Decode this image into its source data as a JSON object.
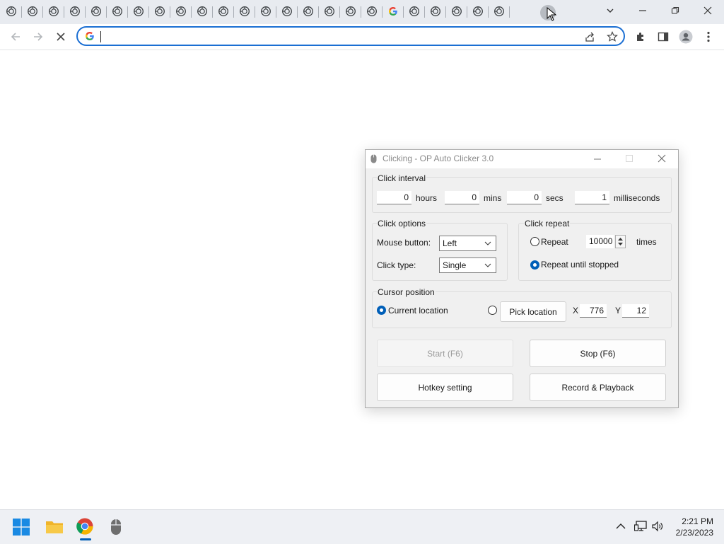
{
  "browser": {
    "tab_count": 24,
    "search_value": "",
    "buttons": {
      "back": "back",
      "forward": "forward",
      "stop": "stop loading",
      "share": "share",
      "bookmark": "bookmark",
      "extensions": "extensions",
      "side_panel": "side panel",
      "profile": "profile",
      "menu": "menu"
    }
  },
  "autoclicker": {
    "title": "Clicking - OP Auto Clicker 3.0",
    "interval": {
      "label": "Click interval",
      "hours_value": "0",
      "hours_label": "hours",
      "mins_value": "0",
      "mins_label": "mins",
      "secs_value": "0",
      "secs_label": "secs",
      "ms_value": "1",
      "ms_label": "milliseconds"
    },
    "options": {
      "label": "Click options",
      "mouse_button_label": "Mouse button:",
      "mouse_button_value": "Left",
      "click_type_label": "Click type:",
      "click_type_value": "Single"
    },
    "repeat": {
      "label": "Click repeat",
      "repeat_label": "Repeat",
      "repeat_count": "10000",
      "times_label": "times",
      "until_stopped_label": "Repeat until stopped",
      "selected": "until_stopped"
    },
    "cursor": {
      "label": "Cursor position",
      "current_label": "Current location",
      "pick_label": "Pick location",
      "x_label": "X",
      "x_value": "776",
      "y_label": "Y",
      "y_value": "12",
      "selected": "current"
    },
    "buttons": {
      "start": "Start (F6)",
      "stop": "Stop (F6)",
      "hotkey": "Hotkey setting",
      "record": "Record & Playback"
    }
  },
  "taskbar": {
    "time": "2:21 PM",
    "date": "2/23/2023"
  },
  "colors": {
    "accent": "#005fb8",
    "omnibox_border": "#1b6fd3",
    "tabstrip_bg": "#e8ebf0"
  }
}
